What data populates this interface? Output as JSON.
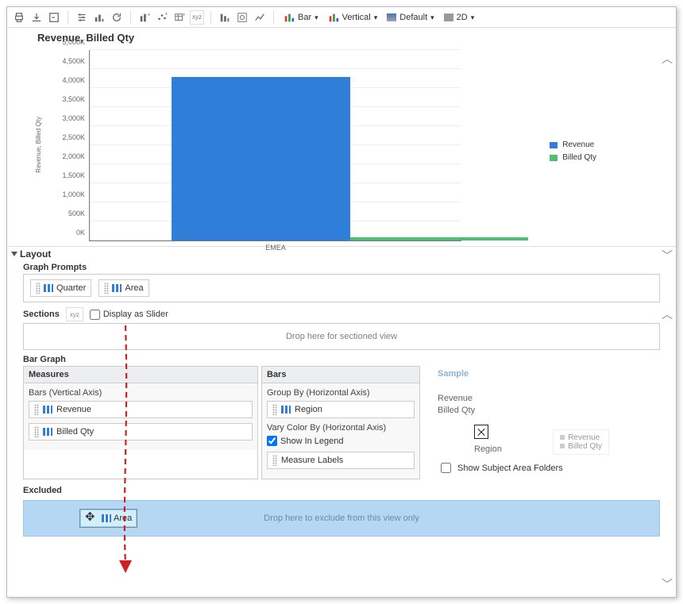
{
  "toolbar": {
    "bar_label": "Bar",
    "vertical_label": "Vertical",
    "style_label": "Default",
    "dim_label": "2D"
  },
  "chart_data": {
    "type": "bar",
    "title": "Revenue, Billed Qty",
    "ylabel": "Revenue, Billed Qty",
    "xlabel": "EMEA",
    "categories": [
      "EMEA"
    ],
    "series": [
      {
        "name": "Revenue",
        "color": "#2f7ed8",
        "values": [
          4300
        ]
      },
      {
        "name": "Billed Qty",
        "color": "#4dbf73",
        "values": [
          90
        ]
      }
    ],
    "ticks": [
      "0K",
      "500K",
      "1,000K",
      "1,500K",
      "2,000K",
      "2,500K",
      "3,000K",
      "3,500K",
      "4,000K",
      "4,500K",
      "5,000K"
    ],
    "ylim": [
      0,
      5000
    ]
  },
  "layout": {
    "header": "Layout",
    "graph_prompts": {
      "label": "Graph Prompts",
      "items": [
        "Quarter",
        "Area"
      ]
    },
    "sections": {
      "label": "Sections",
      "xyz": "xyz",
      "display_as_slider": "Display as Slider",
      "dropzone": "Drop here for sectioned view"
    },
    "bar_graph_label": "Bar Graph",
    "measures": {
      "panel_title": "Measures",
      "sub": "Bars (Vertical Axis)",
      "items": [
        "Revenue",
        "Billed Qty"
      ]
    },
    "bars": {
      "panel_title": "Bars",
      "groupby_sub": "Group By (Horizontal Axis)",
      "groupby_item": "Region",
      "varycolor_sub": "Vary Color By (Horizontal Axis)",
      "show_in_legend": "Show In Legend",
      "measure_labels": "Measure Labels"
    },
    "sample": {
      "title": "Sample",
      "revenue": "Revenue",
      "billed": "Billed Qty",
      "region": "Region"
    },
    "show_subject_folders": "Show Subject Area Folders",
    "excluded": {
      "label": "Excluded",
      "dropzone": "Drop here to exclude from this view only",
      "drag_item": "Area"
    }
  }
}
